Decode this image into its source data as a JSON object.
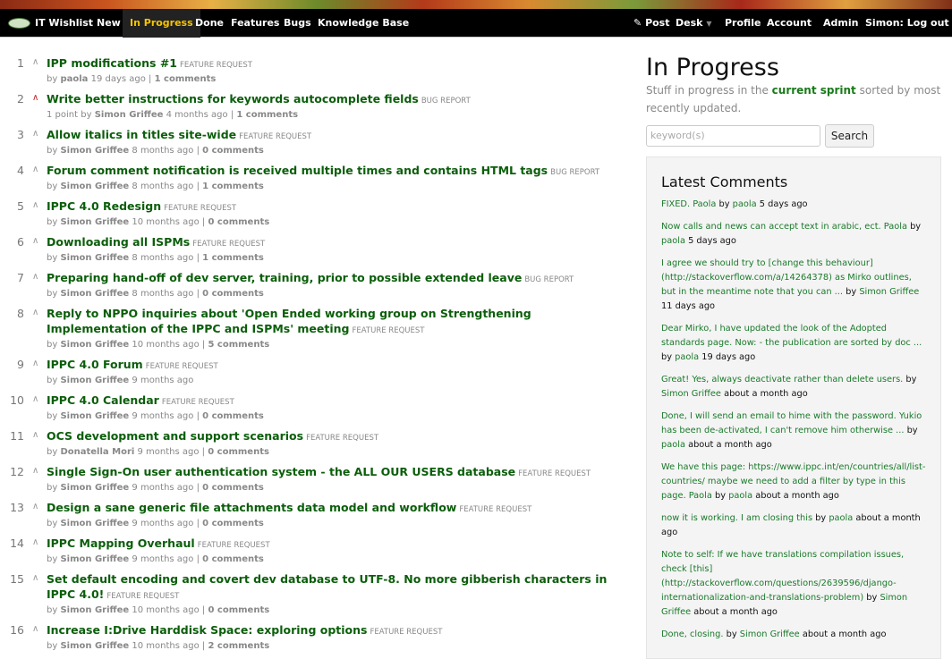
{
  "nav": {
    "brand": "IT Wishlist",
    "left": [
      "New",
      "In Progress",
      "Done",
      "Features",
      "Bugs",
      "Knowledge Base"
    ],
    "active": "In Progress",
    "right": {
      "post": "Post",
      "desk": "Desk",
      "profile": "Profile",
      "account": "Account",
      "admin": "Admin",
      "logout": "Simon: Log out"
    }
  },
  "colors": {
    "link": "#0b5e0b",
    "nav_active": "#f5c400",
    "upvoted": "#b22222"
  },
  "items": [
    {
      "n": "1",
      "title": "IPP modifications #1",
      "type": "FEATURE REQUEST",
      "points": "",
      "author": "paola",
      "time": "19 days ago",
      "comments": "1 comments",
      "upvoted": false
    },
    {
      "n": "2",
      "title": "Write better instructions for keywords autocomplete fields",
      "type": "BUG REPORT",
      "points": "1 point",
      "author": "Simon Griffee",
      "time": "4 months ago",
      "comments": "1 comments",
      "upvoted": true
    },
    {
      "n": "3",
      "title": "Allow italics in titles site-wide",
      "type": "FEATURE REQUEST",
      "points": "",
      "author": "Simon Griffee",
      "time": "8 months ago",
      "comments": "0 comments",
      "upvoted": false
    },
    {
      "n": "4",
      "title": "Forum comment notification is received multiple times and contains HTML tags",
      "type": "BUG REPORT",
      "points": "",
      "author": "Simon Griffee",
      "time": "8 months ago",
      "comments": "1 comments",
      "upvoted": false
    },
    {
      "n": "5",
      "title": "IPPC 4.0 Redesign",
      "type": "FEATURE REQUEST",
      "points": "",
      "author": "Simon Griffee",
      "time": "10 months ago",
      "comments": "0 comments",
      "upvoted": false
    },
    {
      "n": "6",
      "title": "Downloading all ISPMs",
      "type": "FEATURE REQUEST",
      "points": "",
      "author": "Simon Griffee",
      "time": "8 months ago",
      "comments": "1 comments",
      "upvoted": false
    },
    {
      "n": "7",
      "title": "Preparing hand-off of dev server, training, prior to possible extended leave",
      "type": "BUG REPORT",
      "points": "",
      "author": "Simon Griffee",
      "time": "8 months ago",
      "comments": "0 comments",
      "upvoted": false
    },
    {
      "n": "8",
      "title": "Reply to NPPO inquiries about 'Open Ended working group on Strengthening Implementation of the IPPC and ISPMs' meeting",
      "type": "FEATURE REQUEST",
      "points": "",
      "author": "Simon Griffee",
      "time": "10 months ago",
      "comments": "5 comments",
      "upvoted": false
    },
    {
      "n": "9",
      "title": "IPPC 4.0 Forum",
      "type": "FEATURE REQUEST",
      "points": "",
      "author": "Simon Griffee",
      "time": "9 months ago",
      "comments": "",
      "upvoted": false
    },
    {
      "n": "10",
      "title": "IPPC 4.0 Calendar",
      "type": "FEATURE REQUEST",
      "points": "",
      "author": "Simon Griffee",
      "time": "9 months ago",
      "comments": "0 comments",
      "upvoted": false
    },
    {
      "n": "11",
      "title": "OCS development and support scenarios",
      "type": "FEATURE REQUEST",
      "points": "",
      "author": "Donatella Mori",
      "time": "9 months ago",
      "comments": "0 comments",
      "upvoted": false
    },
    {
      "n": "12",
      "title": "Single Sign-On user authentication system - the ALL OUR USERS database",
      "type": "FEATURE REQUEST",
      "points": "",
      "author": "Simon Griffee",
      "time": "9 months ago",
      "comments": "0 comments",
      "upvoted": false
    },
    {
      "n": "13",
      "title": "Design a sane generic file attachments data model and workflow",
      "type": "FEATURE REQUEST",
      "points": "",
      "author": "Simon Griffee",
      "time": "9 months ago",
      "comments": "0 comments",
      "upvoted": false
    },
    {
      "n": "14",
      "title": "IPPC Mapping Overhaul",
      "type": "FEATURE REQUEST",
      "points": "",
      "author": "Simon Griffee",
      "time": "9 months ago",
      "comments": "0 comments",
      "upvoted": false
    },
    {
      "n": "15",
      "title": "Set default encoding and covert dev database to UTF-8. No more gibberish characters in IPPC 4.0!",
      "type": "FEATURE REQUEST",
      "points": "",
      "author": "Simon Griffee",
      "time": "10 months ago",
      "comments": "0 comments",
      "upvoted": false
    },
    {
      "n": "16",
      "title": "Increase I:Drive Harddisk Space: exploring options",
      "type": "FEATURE REQUEST",
      "points": "",
      "author": "Simon Griffee",
      "time": "10 months ago",
      "comments": "2 comments",
      "upvoted": false
    }
  ],
  "sidebar": {
    "title": "In Progress",
    "desc_pre": "Stuff in progress in the ",
    "desc_link": "current sprint",
    "desc_post": " sorted by most recently updated.",
    "search_placeholder": "keyword(s)",
    "search_button": "Search",
    "comments_title": "Latest Comments",
    "comments": [
      {
        "text": "FIXED. Paola",
        "author": "paola",
        "time": "5 days ago"
      },
      {
        "text": "Now calls and news can accept text in arabic, ect. Paola",
        "author": "paola",
        "time": "5 days ago"
      },
      {
        "text": "I agree we should try to [change this behaviour](http://stackoverflow.com/a/14264378) as Mirko outlines, but in the meantime note that you can ...",
        "author": "Simon Griffee",
        "time": "11 days ago"
      },
      {
        "text": "Dear Mirko, I have updated the look of the Adopted standards page. Now: - the publication are sorted by doc ...",
        "author": "paola",
        "time": "19 days ago"
      },
      {
        "text": "Great! Yes, always deactivate rather than delete users.",
        "author": "Simon Griffee",
        "time": "about a month ago"
      },
      {
        "text": "Done, I will send an email to hime with the password. Yukio has been de-activated, I can't remove him otherwise ...",
        "author": "paola",
        "time": "about a month ago"
      },
      {
        "text": "We have this page: https://www.ippc.int/en/countries/all/list-countries/ maybe we need to add a filter by type in this page. Paola",
        "author": "paola",
        "time": "about a month ago"
      },
      {
        "text": "now it is working. I am closing this",
        "author": "paola",
        "time": "about a month ago"
      },
      {
        "text": "Note to self: If we have translations compilation issues, check [this](http://stackoverflow.com/questions/2639596/django-internationalization-and-translations-problem)",
        "author": "Simon Griffee",
        "time": "about a month ago"
      },
      {
        "text": "Done, closing.",
        "author": "Simon Griffee",
        "time": "about a month ago"
      }
    ],
    "by": "by"
  }
}
